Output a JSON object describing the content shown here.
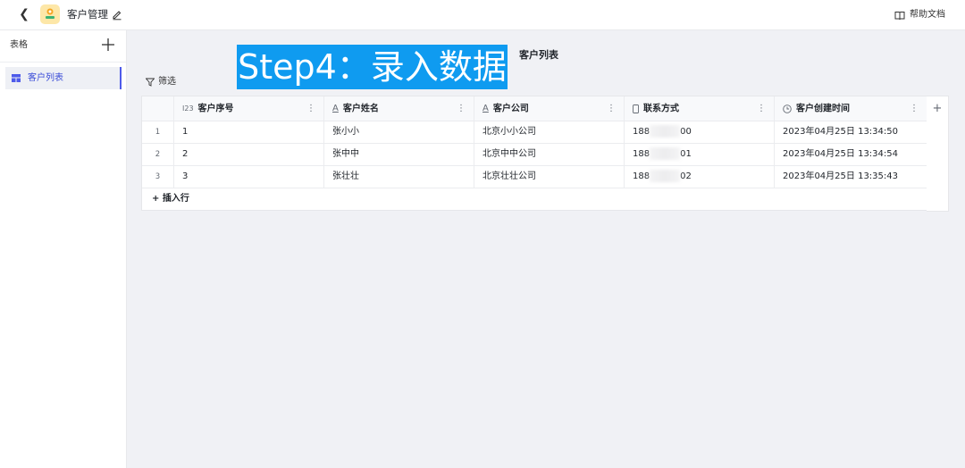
{
  "header": {
    "app_title": "客户管理",
    "help_label": "帮助文档"
  },
  "sidebar": {
    "title": "表格",
    "items": [
      {
        "label": "客户列表"
      }
    ]
  },
  "toolbar": {
    "filter_label": "筛选"
  },
  "overlay": {
    "banner": "Step4：录入数据"
  },
  "table": {
    "title": "客户列表",
    "columns": [
      {
        "icon": "I23",
        "label": "客户序号"
      },
      {
        "icon": "A",
        "label": "客户姓名"
      },
      {
        "icon": "A",
        "label": "客户公司"
      },
      {
        "icon": "phone",
        "label": "联系方式"
      },
      {
        "icon": "clock",
        "label": "客户创建时间"
      }
    ],
    "rows": [
      {
        "index": "1",
        "seq": "1",
        "name": "张小小",
        "company": "北京小小公司",
        "phone_prefix": "188",
        "phone_suffix": "00",
        "created": "2023年04月25日 13:34:50"
      },
      {
        "index": "2",
        "seq": "2",
        "name": "张中中",
        "company": "北京中中公司",
        "phone_prefix": "188",
        "phone_suffix": "01",
        "created": "2023年04月25日 13:34:54"
      },
      {
        "index": "3",
        "seq": "3",
        "name": "张壮壮",
        "company": "北京壮壮公司",
        "phone_prefix": "188",
        "phone_suffix": "02",
        "created": "2023年04月25日 13:35:43"
      }
    ],
    "insert_row_label": "+ 插入行",
    "add_column_label": "+"
  },
  "colors": {
    "accent": "#4e5bea",
    "banner_bg": "#0f9bf0"
  }
}
